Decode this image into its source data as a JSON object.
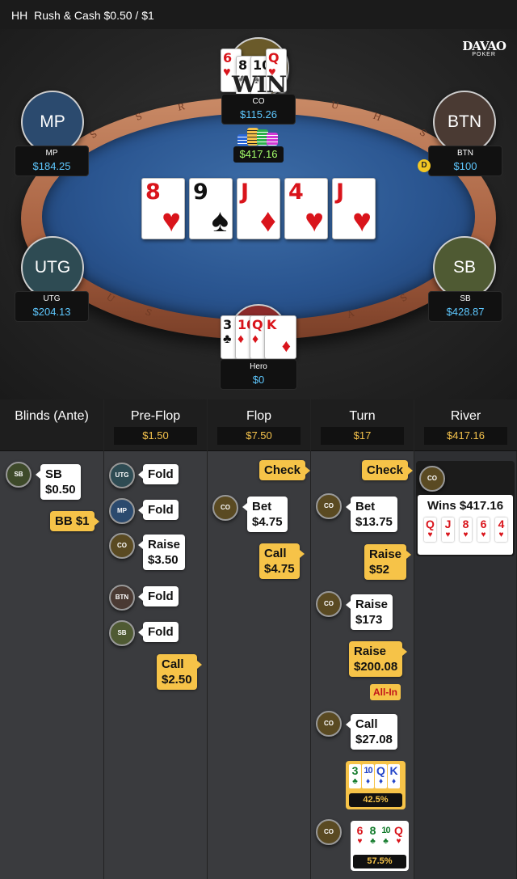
{
  "header": {
    "hand_type": "HH",
    "game": "Rush & Cash $0.50 / $1"
  },
  "logo": {
    "top": "DAVAO",
    "sub": "POKER"
  },
  "table": {
    "rail_letters": [
      "S",
      "S",
      "R",
      "U",
      "H",
      "S",
      "U",
      "S",
      "A",
      "S"
    ],
    "pot_label": "$417.16",
    "win_label": "WIN",
    "board": [
      {
        "rank": "8",
        "suit": "♥",
        "color": "red"
      },
      {
        "rank": "9",
        "suit": "♠",
        "color": "blk"
      },
      {
        "rank": "J",
        "suit": "♦",
        "color": "red"
      },
      {
        "rank": "4",
        "suit": "♥",
        "color": "red"
      },
      {
        "rank": "J",
        "suit": "♥",
        "color": "red"
      }
    ],
    "seats": {
      "mp": {
        "circle": "MP",
        "name": "MP",
        "stack": "$184.25",
        "color": "#2b4a6e"
      },
      "btn": {
        "circle": "BTN",
        "name": "BTN",
        "stack": "$100",
        "color": "#4a3a33"
      },
      "utg": {
        "circle": "UTG",
        "name": "UTG",
        "stack": "$204.13",
        "color": "#2e4b53"
      },
      "sb": {
        "circle": "SB",
        "name": "SB",
        "stack": "$428.87",
        "color": "#4f5a33"
      },
      "co": {
        "name": "CO",
        "stack": "$115.26"
      },
      "hero": {
        "name": "Hero",
        "stack": "$0"
      }
    },
    "dealer_button": "D",
    "co_cards": [
      {
        "rank": "6",
        "suit": "♥",
        "color": "red"
      },
      {
        "rank": "8",
        "suit": "♣",
        "color": "blk"
      },
      {
        "rank": "10",
        "suit": "♠",
        "color": "blk"
      },
      {
        "rank": "Q",
        "suit": "♥",
        "color": "red"
      }
    ],
    "hero_cards": [
      {
        "rank": "3",
        "suit": "♣",
        "color": "blk"
      },
      {
        "rank": "10",
        "suit": "♦",
        "color": "red"
      },
      {
        "rank": "Q",
        "suit": "♦",
        "color": "red"
      },
      {
        "rank": "K",
        "suit": "♦",
        "color": "red"
      }
    ]
  },
  "columns": [
    {
      "title": "Blinds (Ante)",
      "pot": ""
    },
    {
      "title": "Pre-Flop",
      "pot": "$1.50"
    },
    {
      "title": "Flop",
      "pot": "$7.50"
    },
    {
      "title": "Turn",
      "pot": "$17"
    },
    {
      "title": "River",
      "pot": "$417.16"
    }
  ],
  "actions": {
    "blinds": {
      "sb_avatar": "SB",
      "sb_action": "SB",
      "sb_amount": "$0.50",
      "bb_action": "BB",
      "bb_amount": "$1"
    },
    "preflop": [
      {
        "avatar": "UTG",
        "action": "Fold",
        "amount": ""
      },
      {
        "avatar": "MP",
        "action": "Fold",
        "amount": ""
      },
      {
        "avatar": "CO",
        "action": "Raise",
        "amount": "$3.50"
      },
      {
        "avatar": "BTN",
        "action": "Fold",
        "amount": ""
      },
      {
        "avatar": "SB",
        "action": "Fold",
        "amount": ""
      },
      {
        "avatar": "",
        "action": "Call",
        "amount": "$2.50"
      }
    ],
    "flop": [
      {
        "avatar": "",
        "action": "Check",
        "amount": ""
      },
      {
        "avatar": "CO",
        "action": "Bet",
        "amount": "$4.75"
      },
      {
        "avatar": "",
        "action": "Call",
        "amount": "$4.75"
      }
    ],
    "turn": [
      {
        "avatar": "",
        "action": "Check",
        "amount": ""
      },
      {
        "avatar": "CO",
        "action": "Bet",
        "amount": "$13.75"
      },
      {
        "avatar": "",
        "action": "Raise",
        "amount": "$52"
      },
      {
        "avatar": "CO",
        "action": "Raise",
        "amount": "$173"
      },
      {
        "avatar": "",
        "action": "Raise",
        "amount": "$200.08"
      },
      {
        "avatar": "CO",
        "action": "Call",
        "amount": "$27.08"
      }
    ],
    "allin_label": "All-In",
    "hero_showdown": {
      "cards": [
        {
          "rank": "3",
          "suit": "♣",
          "color": "green"
        },
        {
          "rank": "10",
          "suit": "♦",
          "color": "blue"
        },
        {
          "rank": "Q",
          "suit": "♦",
          "color": "blue"
        },
        {
          "rank": "K",
          "suit": "♦",
          "color": "blue"
        }
      ],
      "equity": "42.5%"
    },
    "co_showdown": {
      "avatar": "CO",
      "cards": [
        {
          "rank": "6",
          "suit": "♥",
          "color": "red"
        },
        {
          "rank": "8",
          "suit": "♣",
          "color": "green"
        },
        {
          "rank": "10",
          "suit": "♣",
          "color": "green"
        },
        {
          "rank": "Q",
          "suit": "♥",
          "color": "red"
        }
      ],
      "equity": "57.5%"
    },
    "river": {
      "avatar": "CO",
      "win_text": "Wins $417.16",
      "cards": [
        {
          "rank": "Q",
          "suit": "♥",
          "color": "red"
        },
        {
          "rank": "J",
          "suit": "♥",
          "color": "red"
        },
        {
          "rank": "8",
          "suit": "♥",
          "color": "red"
        },
        {
          "rank": "6",
          "suit": "♥",
          "color": "red"
        },
        {
          "rank": "4",
          "suit": "♥",
          "color": "red"
        }
      ]
    }
  }
}
